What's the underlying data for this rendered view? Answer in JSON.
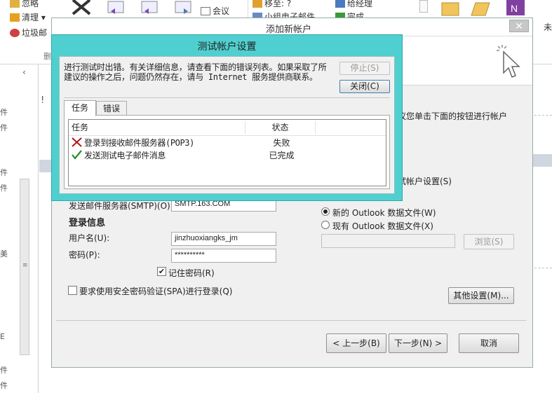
{
  "ribbon": {
    "ignore": "忽略",
    "clean": "清理",
    "junk": "垃圾邮",
    "delete_group": "删",
    "meeting": "会议",
    "move_to": "移至: ?",
    "to_manager": "给经理",
    "team_email": "小组电子邮件",
    "done": "完成",
    "unread": "未"
  },
  "left_marks": [
    "!",
    "件",
    "件",
    "件",
    "件",
    "美",
    "E",
    "件",
    "件"
  ],
  "main_dialog": {
    "title": "添加新帐户",
    "close": "✕",
    "instruction_fragment": "议您单击下面的按钮进行帐户",
    "test_settings_label": "试帐户设置(S)",
    "smtp_label": "发送邮件服务器(SMTP)(O):",
    "smtp_value": "SMTP.163.COM",
    "login_section": "登录信息",
    "username_label": "用户名(U):",
    "username_value": "jinzhuoxiangks_jm",
    "password_label": "密码(P):",
    "password_value": "**********",
    "remember_password": "记住密码(R)",
    "spa_label": "要求使用安全密码验证(SPA)进行登录(Q)",
    "new_data_file": "新的 Outlook 数据文件(W)",
    "existing_data_file": "现有 Outlook 数据文件(X)",
    "browse": "浏览(S)",
    "more_settings": "其他设置(M)...",
    "back": "< 上一步(B)",
    "next": "下一步(N) >",
    "cancel": "取消"
  },
  "test_dialog": {
    "title": "测试帐户设置",
    "message": "进行测试时出错。有关详细信息，请查看下面的错误列表。如果采取了所建议的操作之后，问题仍然存在，请与 Internet 服务提供商联系。",
    "stop": "停止(S)",
    "close": "关闭(C)",
    "tabs": [
      "任务",
      "错误"
    ],
    "columns": [
      "任务",
      "状态"
    ],
    "tasks": [
      {
        "name": "登录到接收邮件服务器(POP3)",
        "status": "失败",
        "icon": "red-x-icon"
      },
      {
        "name": "发送测试电子邮件消息",
        "status": "已完成",
        "icon": "green-check-icon"
      }
    ]
  },
  "colors": {
    "test_dialog_frame": "#4fcfd0",
    "fail_icon": "#b01818",
    "success_icon": "#2a8a2a"
  }
}
